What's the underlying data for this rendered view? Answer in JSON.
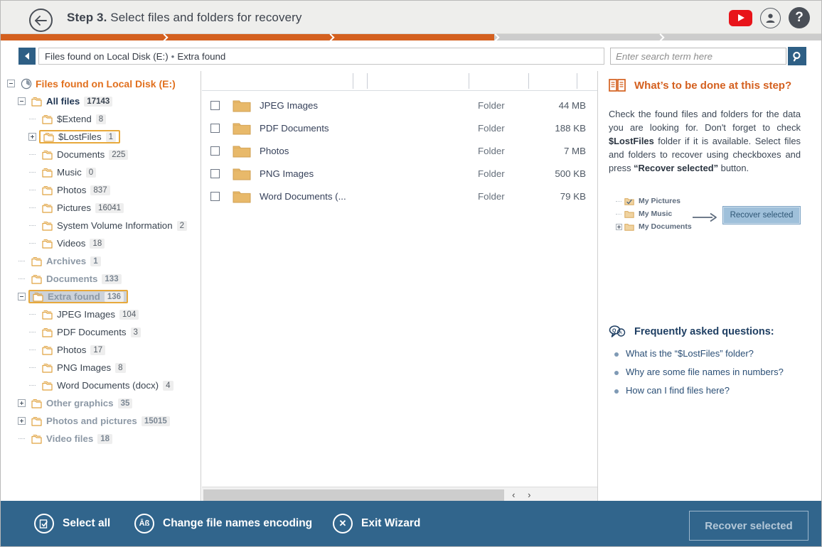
{
  "header": {
    "step_label": "Step 3.",
    "step_title": "Select files and folders for recovery",
    "back_icon": "arrow-left-icon",
    "youtube_icon": "youtube-icon",
    "account_icon": "account-icon",
    "help_icon": "help-icon",
    "help_glyph": "?"
  },
  "progress": {
    "percent": 60,
    "fill_color": "#d4601f",
    "track_color": "#cccccc"
  },
  "breadcrumb": {
    "back_button_icon": "chevron-left-icon",
    "root": "Files found on Local Disk (E:)",
    "separator": "•",
    "current": "Extra found"
  },
  "search": {
    "placeholder": "Enter search term here",
    "value": "",
    "button_icon": "search-icon"
  },
  "tree": {
    "nodes": [
      {
        "label": "Files found on Local Disk (E:)",
        "count": "",
        "indent": 0,
        "toggle": "minus",
        "style": "root",
        "icon": "disk-clock-icon"
      },
      {
        "label": "All files",
        "count": "17143",
        "indent": 1,
        "toggle": "minus",
        "style": "allfiles",
        "icon": "folder-icon"
      },
      {
        "label": "$Extend",
        "count": "8",
        "indent": 2,
        "toggle": "dots",
        "style": "child",
        "icon": "folder-icon"
      },
      {
        "label": "$LostFiles",
        "count": "1",
        "indent": 2,
        "toggle": "plus",
        "style": "child",
        "icon": "folder-icon",
        "highlight": true
      },
      {
        "label": "Documents",
        "count": "225",
        "indent": 2,
        "toggle": "dots",
        "style": "child",
        "icon": "folder-icon"
      },
      {
        "label": "Music",
        "count": "0",
        "indent": 2,
        "toggle": "dots",
        "style": "child",
        "icon": "folder-icon"
      },
      {
        "label": "Photos",
        "count": "837",
        "indent": 2,
        "toggle": "dots",
        "style": "child",
        "icon": "folder-icon"
      },
      {
        "label": "Pictures",
        "count": "16041",
        "indent": 2,
        "toggle": "dots",
        "style": "child",
        "icon": "folder-icon"
      },
      {
        "label": "System Volume Information",
        "count": "2",
        "indent": 2,
        "toggle": "dots",
        "style": "child",
        "icon": "folder-icon"
      },
      {
        "label": "Videos",
        "count": "18",
        "indent": 2,
        "toggle": "dots",
        "style": "child",
        "icon": "folder-icon"
      },
      {
        "label": "Archives",
        "count": "1",
        "indent": 1,
        "toggle": "dots",
        "style": "group",
        "icon": "folder-icon"
      },
      {
        "label": "Documents",
        "count": "133",
        "indent": 1,
        "toggle": "dots",
        "style": "group",
        "icon": "folder-icon"
      },
      {
        "label": "Extra found",
        "count": "136",
        "indent": 1,
        "toggle": "minus",
        "style": "group",
        "icon": "folder-icon",
        "highlight": true,
        "selected": true
      },
      {
        "label": "JPEG Images",
        "count": "104",
        "indent": 2,
        "toggle": "dots",
        "style": "child",
        "icon": "folder-icon"
      },
      {
        "label": "PDF Documents",
        "count": "3",
        "indent": 2,
        "toggle": "dots",
        "style": "child",
        "icon": "folder-icon"
      },
      {
        "label": "Photos",
        "count": "17",
        "indent": 2,
        "toggle": "dots",
        "style": "child",
        "icon": "folder-icon"
      },
      {
        "label": "PNG Images",
        "count": "8",
        "indent": 2,
        "toggle": "dots",
        "style": "child",
        "icon": "folder-icon"
      },
      {
        "label": "Word Documents (docx)",
        "count": "4",
        "indent": 2,
        "toggle": "dots",
        "style": "child",
        "icon": "folder-icon"
      },
      {
        "label": "Other graphics",
        "count": "35",
        "indent": 1,
        "toggle": "plus",
        "style": "group",
        "icon": "folder-icon"
      },
      {
        "label": "Photos and pictures",
        "count": "15015",
        "indent": 1,
        "toggle": "plus",
        "style": "group",
        "icon": "folder-icon"
      },
      {
        "label": "Video files",
        "count": "18",
        "indent": 1,
        "toggle": "dots",
        "style": "group",
        "icon": "folder-icon"
      }
    ]
  },
  "filelist": {
    "columns": [
      "",
      "",
      "",
      ""
    ],
    "rows": [
      {
        "name": "JPEG Images",
        "type": "Folder",
        "size": "44 MB",
        "checked": false,
        "icon": "folder-icon"
      },
      {
        "name": "PDF Documents",
        "type": "Folder",
        "size": "188 KB",
        "checked": false,
        "icon": "folder-icon"
      },
      {
        "name": "Photos",
        "type": "Folder",
        "size": "7 MB",
        "checked": false,
        "icon": "folder-icon"
      },
      {
        "name": "PNG Images",
        "type": "Folder",
        "size": "500 KB",
        "checked": false,
        "icon": "folder-icon"
      },
      {
        "name": "Word Documents (...",
        "type": "Folder",
        "size": "79 KB",
        "checked": false,
        "icon": "folder-icon"
      }
    ],
    "scroll": {
      "thumb_percent": 83,
      "left_arrow": "‹",
      "right_arrow": "›"
    }
  },
  "info": {
    "title": "What’s to be done at this step?",
    "title_icon": "book-icon",
    "body_1": "Check the found files and folders for the data you are looking for. Don't forget to check ",
    "body_bold_1": "$LostFiles",
    "body_2": " folder if it is available. Select files and folders to recover using checkboxes and press ",
    "body_bold_2": "“Recover selected”",
    "body_3": " button.",
    "illustration": {
      "items": [
        "My Pictures",
        "My Music",
        "My Documents"
      ],
      "arrow_icon": "arrow-right-icon",
      "button_label": "Recover selected"
    },
    "faq_title": "Frequently asked questions:",
    "faq_icon": "faq-bubble-icon",
    "faq_items": [
      "What is the “$LostFiles” folder?",
      "Why are some file names in numbers?",
      "How can I find files here?"
    ]
  },
  "footer": {
    "select_all": "Select all",
    "select_all_icon": "select-all-icon",
    "change_encoding": "Change file names encoding",
    "change_encoding_icon": "encoding-icon",
    "change_encoding_glyph": "Āß",
    "exit_wizard": "Exit Wizard",
    "exit_wizard_icon": "close-icon",
    "exit_glyph": "✕",
    "recover_selected": "Recover selected"
  },
  "colors": {
    "accent_orange": "#d4601f",
    "footer_blue": "#31658c",
    "header_bg": "#eeeeec",
    "highlight_border": "#e7a93c",
    "folder_gold": "#e8b96a"
  }
}
